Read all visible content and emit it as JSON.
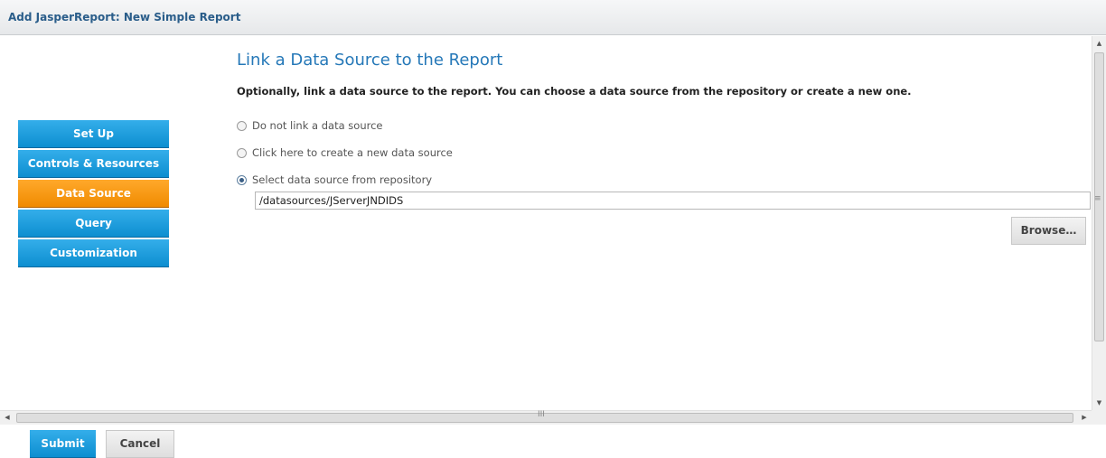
{
  "dialog": {
    "title": "Add JasperReport: New Simple Report"
  },
  "nav": {
    "items": [
      {
        "label": "Set Up",
        "active": false
      },
      {
        "label": "Controls & Resources",
        "active": false
      },
      {
        "label": "Data Source",
        "active": true
      },
      {
        "label": "Query",
        "active": false
      },
      {
        "label": "Customization",
        "active": false
      }
    ]
  },
  "main": {
    "title": "Link a Data Source to the Report",
    "instructions": "Optionally, link a data source to the report. You can choose a data source from the repository or create a new one.",
    "options": [
      {
        "label": "Do not link a data source",
        "checked": false
      },
      {
        "label": "Click here to create a new data source",
        "checked": false
      },
      {
        "label": "Select data source from repository",
        "checked": true
      }
    ],
    "repository_path": "/datasources/JServerJNDIDS",
    "browse_label": "Browse…"
  },
  "footer": {
    "submit_label": "Submit",
    "cancel_label": "Cancel"
  },
  "colors": {
    "nav_blue": "#1a9ddb",
    "nav_active_orange": "#f7961a",
    "title_blue": "#2578b8"
  }
}
